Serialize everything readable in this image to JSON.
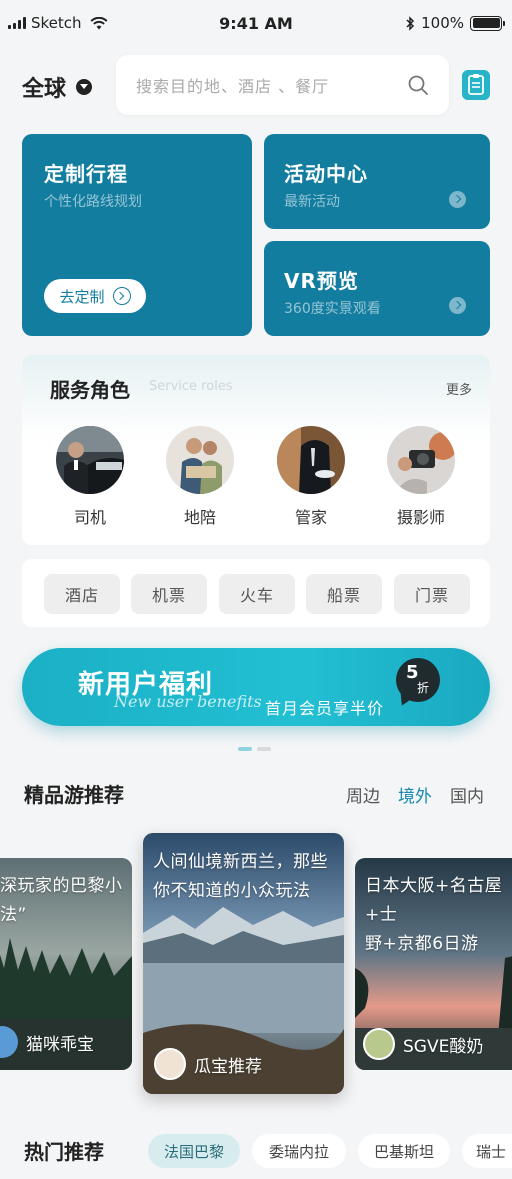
{
  "status_bar": {
    "carrier": "Sketch",
    "time": "9:41 AM",
    "battery": "100%"
  },
  "header": {
    "region": "全球",
    "search_placeholder": "搜索目的地、酒店 、餐厅"
  },
  "feature_cards": [
    {
      "title": "定制行程",
      "subtitle": "个性化路线规划",
      "button": "去定制"
    },
    {
      "title": "活动中心",
      "subtitle": "最新活动"
    },
    {
      "title": "VR预览",
      "subtitle": "360度实景观看"
    }
  ],
  "service_roles": {
    "title": "服务角色",
    "subtitle": "Service roles",
    "more": "更多",
    "items": [
      "司机",
      "地陪",
      "管家",
      "摄影师"
    ]
  },
  "categories": [
    "酒店",
    "机票",
    "火车",
    "船票",
    "门票"
  ],
  "banner": {
    "title": "新用户福利",
    "script": "New user benefits",
    "offer": "首月会员享半价",
    "discount_num": "5",
    "discount_unit": "折"
  },
  "recommend": {
    "title": "精品游推荐",
    "tabs": [
      "周边",
      "境外",
      "国内"
    ],
    "active_tab": "境外",
    "posts": [
      {
        "caption_l1": "深玩家的巴黎小",
        "caption_l2": "法”",
        "author": "猫咪乖宝"
      },
      {
        "caption_l1": "人间仙境新西兰，那些",
        "caption_l2": "你不知道的小众玩法",
        "author": "瓜宝推荐"
      },
      {
        "caption_l1": "日本大阪+名古屋+士",
        "caption_l2": "野+京都6日游",
        "author": "SGVE酸奶"
      }
    ]
  },
  "hot": {
    "title": "热门推荐",
    "chips": [
      "法国巴黎",
      "委瑞内拉",
      "巴基斯坦",
      "瑞士"
    ]
  },
  "colors": {
    "primary": "#137da0",
    "accent": "#22bfd3",
    "tab_active": "#1689b0"
  }
}
